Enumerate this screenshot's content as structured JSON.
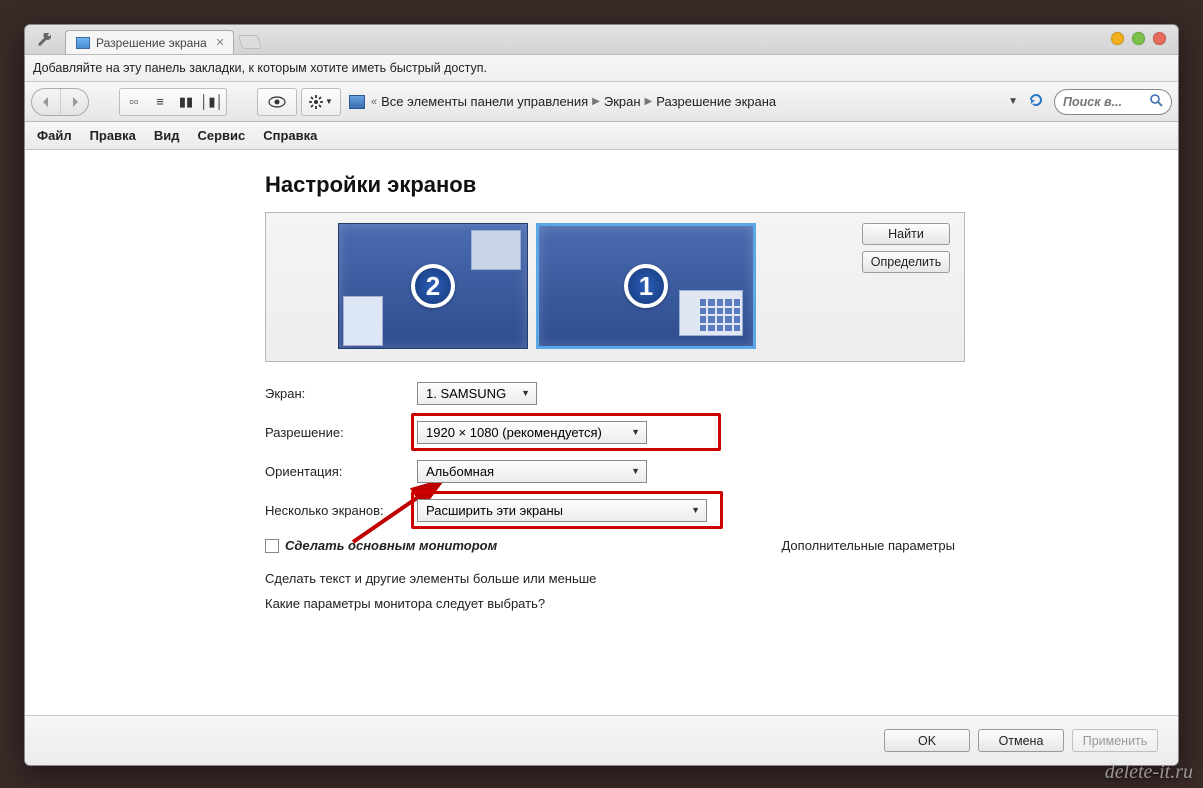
{
  "tab": {
    "title": "Разрешение экрана"
  },
  "bookmark_hint": "Добавляйте на эту панель закладки, к которым хотите иметь быстрый доступ.",
  "breadcrumb": {
    "items": [
      "Все элементы панели управления",
      "Экран",
      "Разрешение экрана"
    ]
  },
  "search": {
    "placeholder": "Поиск в..."
  },
  "menubar": [
    "Файл",
    "Правка",
    "Вид",
    "Сервис",
    "Справка"
  ],
  "page": {
    "title": "Настройки экранов",
    "buttons": {
      "detect": "Найти",
      "identify": "Определить"
    },
    "monitors": {
      "primary_num": "1",
      "secondary_num": "2"
    },
    "labels": {
      "display": "Экран:",
      "resolution": "Разрешение:",
      "orientation": "Ориентация:",
      "multiple": "Несколько экранов:"
    },
    "values": {
      "display": "1. SAMSUNG",
      "resolution": "1920 × 1080 (рекомендуется)",
      "orientation": "Альбомная",
      "multiple": "Расширить эти экраны"
    },
    "checkbox": "Сделать основным монитором",
    "advanced": "Дополнительные параметры",
    "links": {
      "textsize": "Сделать текст и другие элементы больше или меньше",
      "which": "Какие параметры монитора следует выбрать?"
    }
  },
  "footer": {
    "ok": "OK",
    "cancel": "Отмена",
    "apply": "Применить"
  },
  "watermark": "delete-it.ru"
}
